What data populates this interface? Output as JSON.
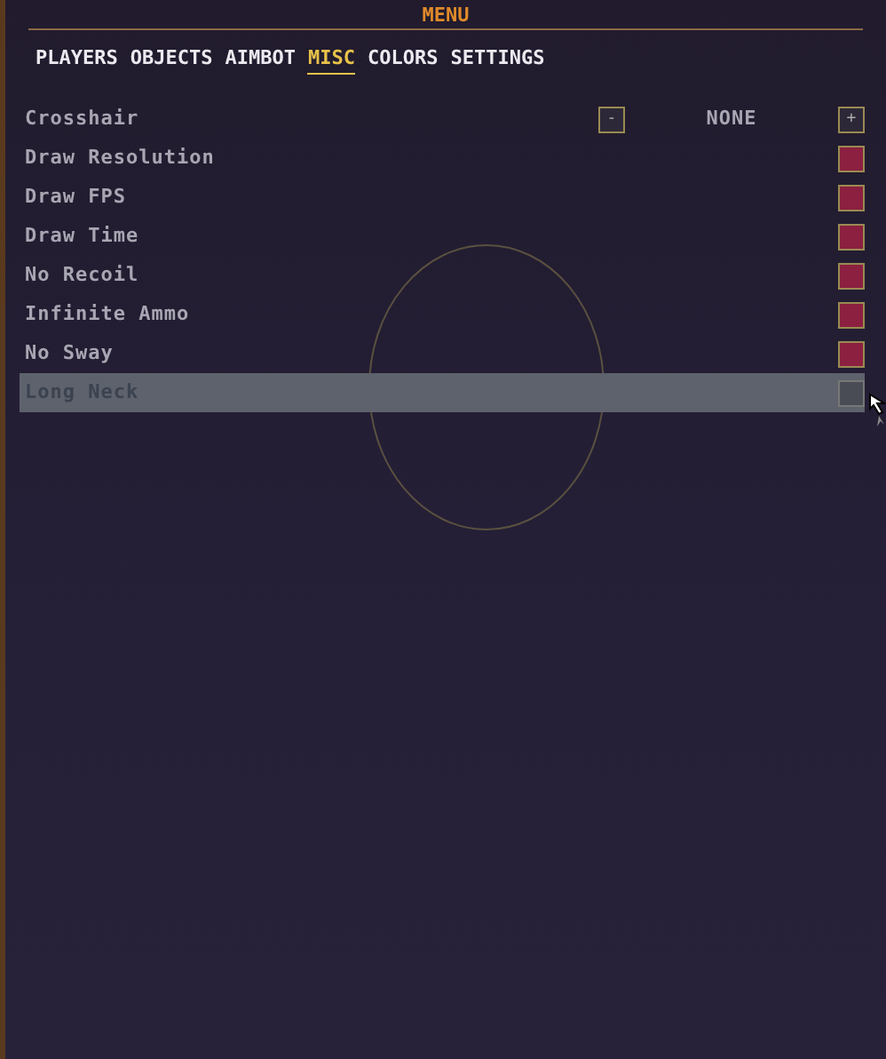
{
  "window": {
    "title": "MENU"
  },
  "tabs": [
    {
      "label": "PLAYERS",
      "selected": false
    },
    {
      "label": "OBJECTS",
      "selected": false
    },
    {
      "label": "AIMBOT",
      "selected": false
    },
    {
      "label": "MISC",
      "selected": true
    },
    {
      "label": "COLORS",
      "selected": false
    },
    {
      "label": "SETTINGS",
      "selected": false
    }
  ],
  "options": [
    {
      "kind": "selector",
      "label": "Crosshair",
      "minus": "-",
      "value": "NONE",
      "plus": "+",
      "hovered": false
    },
    {
      "kind": "toggle",
      "label": "Draw Resolution",
      "checked": true,
      "hovered": false
    },
    {
      "kind": "toggle",
      "label": "Draw FPS",
      "checked": true,
      "hovered": false
    },
    {
      "kind": "toggle",
      "label": "Draw Time",
      "checked": true,
      "hovered": false
    },
    {
      "kind": "toggle",
      "label": "No Recoil",
      "checked": true,
      "hovered": false
    },
    {
      "kind": "toggle",
      "label": "Infinite Ammo",
      "checked": true,
      "hovered": false
    },
    {
      "kind": "toggle",
      "label": "No Sway",
      "checked": true,
      "hovered": false
    },
    {
      "kind": "toggle",
      "label": "Long Neck",
      "checked": false,
      "hovered": true
    }
  ]
}
